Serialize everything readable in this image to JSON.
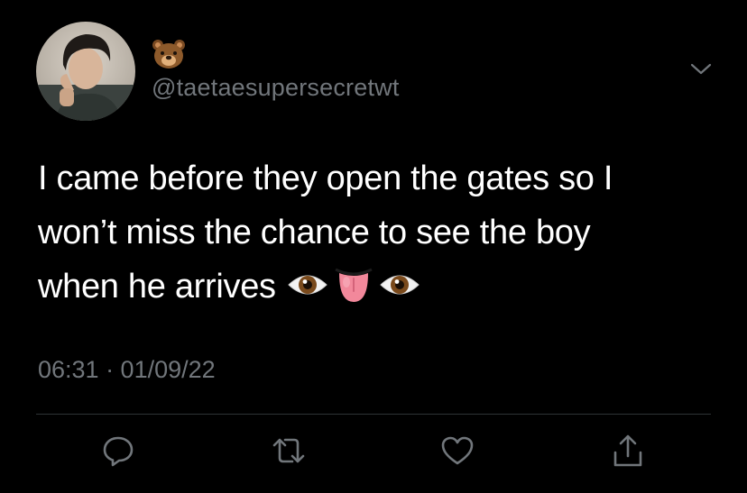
{
  "tweet": {
    "display_name_icon": "bear-face-emoji",
    "handle": "@taetaesupersecretwt",
    "text_lines": [
      "I came before they open the gates so I",
      "won’t miss the chance to see the boy",
      "when he arrives"
    ],
    "trailing_emojis": [
      "eye-emoji",
      "tongue-emoji",
      "eye-emoji"
    ],
    "timestamp": "06:31 · 01/09/22"
  },
  "actions": [
    "reply-icon",
    "retweet-icon",
    "like-icon",
    "share-icon"
  ],
  "colors": {
    "background": "#000000",
    "text": "#ffffff",
    "secondary_text": "#71767b",
    "divider": "#2f3336"
  }
}
